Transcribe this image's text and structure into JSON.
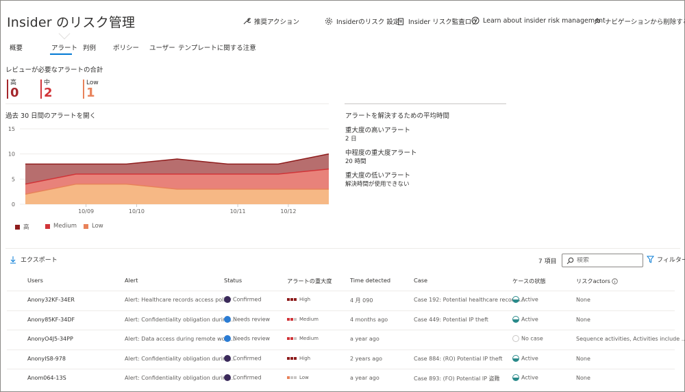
{
  "header": {
    "title": "Insider のリスク管理",
    "links": {
      "recommended": "推奨アクション",
      "settings": "Insiderのリスク 設定",
      "audit": "Insider リスク監査ログ",
      "learn": "Learn about insider risk management",
      "remove": "ナビゲーションから削除する"
    }
  },
  "tabs": [
    "概要",
    "アラート",
    "判例",
    "ポリシー",
    "ユーザー",
    "テンプレートに関する注意"
  ],
  "summary": {
    "title": "レビューが必要なアラートの合計",
    "high_label": "高",
    "high_count": "0",
    "medium_label": "中",
    "medium_count": "2",
    "low_label": "Low",
    "low_count": "1",
    "colors": {
      "high": "#a4262c",
      "medium": "#d13438",
      "low": "#e8825a"
    }
  },
  "chart_data": {
    "type": "area",
    "title": "過去 30 日間のアラートを開く",
    "x": [
      "",
      "10/09",
      "10/10",
      "",
      "10/11",
      "10/12",
      ""
    ],
    "y_ticks": [
      "15",
      "10",
      "5",
      "0"
    ],
    "ylim": [
      0,
      15
    ],
    "series": [
      {
        "name": "高",
        "values": [
          8,
          8,
          8,
          9,
          8,
          8,
          10
        ],
        "color": "#b76e6e",
        "line": "#8e1c1c"
      },
      {
        "name": "Medium",
        "values": [
          4,
          6,
          6,
          6,
          6,
          6,
          7
        ],
        "color": "#e8827a",
        "line": "#d13438"
      },
      {
        "name": "Low",
        "values": [
          2,
          4,
          4,
          3,
          3,
          3,
          3
        ],
        "color": "#f6b885",
        "line": "#e8825a"
      }
    ],
    "legend": [
      "高",
      "Medium",
      "Low"
    ],
    "legend_position": "bottom-left"
  },
  "avg_time": {
    "title": "アラートを解決するための平均時間",
    "items": [
      {
        "label": "重大度の高いアラート",
        "value": "2 日"
      },
      {
        "label": "中程度の重大度アラート",
        "value": "20 時間"
      },
      {
        "label": "重大度の低いアラート",
        "value": "解決時間が使用できない"
      }
    ]
  },
  "toolbar": {
    "export": "エクスポート",
    "items_count": "7 項目",
    "search_placeholder": "検索",
    "filter": "フィルター"
  },
  "table": {
    "headers": [
      "Users",
      "Alert",
      "Status",
      "アラートの重大度",
      "Time detected",
      "Case",
      "ケースの状態",
      "リスクactors"
    ],
    "rows": [
      {
        "user": "Anony32KF-34ER",
        "alert": "Alert: Healthcare records access policy",
        "status": "Confirmed",
        "status_color": "#3b2a5a",
        "severity": "High",
        "sev_colors": [
          "#8e1c1c",
          "#8e1c1c",
          "#8e1c1c"
        ],
        "time": "4 月 090",
        "case": "Case 192: Potential healthcare records...",
        "case_state": "Active",
        "risk": "None"
      },
      {
        "user": "Anony85KF-34DF",
        "alert": "Alert: Confidentiality obligation during...",
        "status": "Needs review",
        "status_color": "#2b7cd3",
        "severity": "Medium",
        "sev_colors": [
          "#d13438",
          "#d13438",
          "#c8c6c4"
        ],
        "time": "4 months ago",
        "case": "Case 449: Potential IP theft",
        "case_state": "Active",
        "risk": "None"
      },
      {
        "user": "AnonyO4J5-34PP",
        "alert": "Alert: Data access during remote work...",
        "status": "Needs review",
        "status_color": "#2b7cd3",
        "severity": "Medium",
        "sev_colors": [
          "#d13438",
          "#d13438",
          "#c8c6c4"
        ],
        "time": "a year ago",
        "case": "",
        "case_state": "No case",
        "risk": "Sequence activities, Activities include ..."
      },
      {
        "user": "AnonyIS8-978",
        "alert": "Alert: Confidentiality obligation during...",
        "status": "Confirmed",
        "status_color": "#3b2a5a",
        "severity": "High",
        "sev_colors": [
          "#8e1c1c",
          "#8e1c1c",
          "#8e1c1c"
        ],
        "time": "2 years ago",
        "case": "Case 884: (RO) Potential IP theft",
        "case_state": "Active",
        "risk": "None"
      },
      {
        "user": "Anom064-13S",
        "alert": "Alert: Confidentiality obligation during...",
        "status": "Confirmed",
        "status_color": "#3b2a5a",
        "severity": "Low",
        "sev_colors": [
          "#e8825a",
          "#c8c6c4",
          "#c8c6c4"
        ],
        "time": "a year ago",
        "case": "Case 893: (FO) Potential IP 盗難",
        "case_state": "Active",
        "risk": "None"
      }
    ]
  }
}
